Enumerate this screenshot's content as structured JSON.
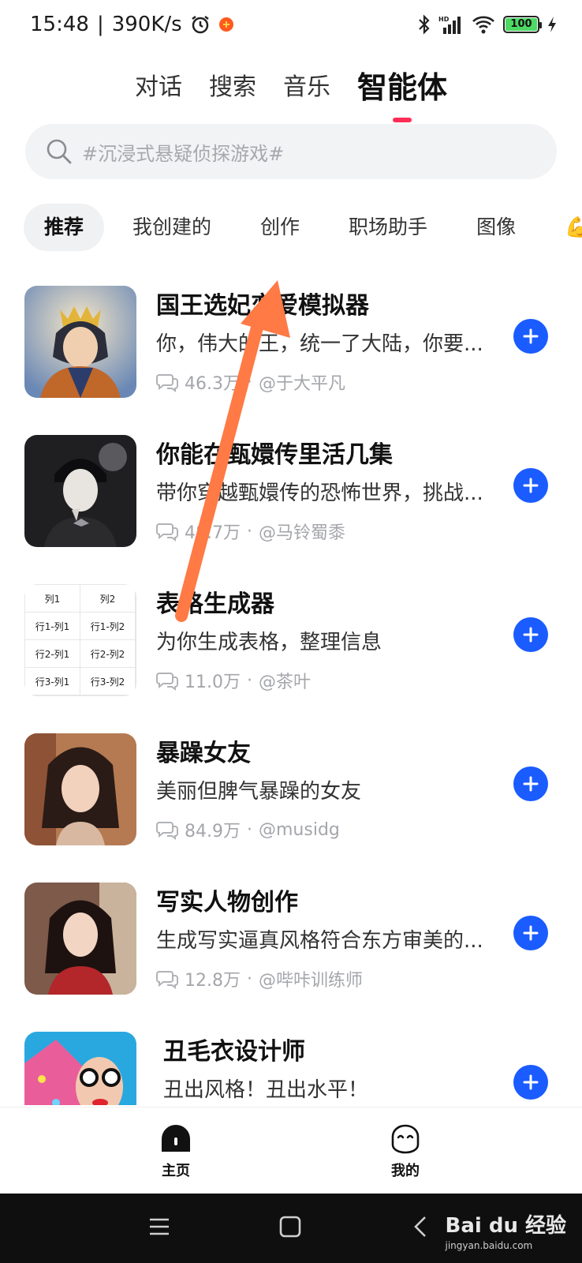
{
  "status": {
    "time": "15:48",
    "speed": "390K/s",
    "battery": "100"
  },
  "top_tabs": [
    {
      "label": "对话",
      "active": false
    },
    {
      "label": "搜索",
      "active": false
    },
    {
      "label": "音乐",
      "active": false
    },
    {
      "label": "智能体",
      "active": true
    }
  ],
  "search": {
    "placeholder": "#沉浸式悬疑侦探游戏#"
  },
  "categories": [
    {
      "label": "推荐",
      "active": true
    },
    {
      "label": "我创建的"
    },
    {
      "label": "创作"
    },
    {
      "label": "职场助手"
    },
    {
      "label": "图像"
    },
    {
      "label": "💪"
    }
  ],
  "items": [
    {
      "title": "国王选妃恋爱模拟器",
      "desc": "你，伟大的王，统一了大陆，你要...",
      "count": "46.3万",
      "author": "@于大平凡"
    },
    {
      "title": "你能在甄嬛传里活几集",
      "desc": "带你穿越甄嬛传的恐怖世界，挑战...",
      "count": "48.7万",
      "author": "@马铃蜀黍"
    },
    {
      "title": "表格生成器",
      "desc": "为你生成表格，整理信息",
      "count": "11.0万",
      "author": "@茶叶"
    },
    {
      "title": "暴躁女友",
      "desc": "美丽但脾气暴躁的女友",
      "count": "84.9万",
      "author": "@musidg"
    },
    {
      "title": "写实人物创作",
      "desc": "生成写实逼真风格符合东方审美的...",
      "count": "12.8万",
      "author": "@哔咔训练师"
    },
    {
      "title": "丑毛衣设计师",
      "desc": "丑出风格！丑出水平！",
      "count": "",
      "author": ""
    }
  ],
  "table_thumb": {
    "cells": [
      "列1",
      "列2",
      "行1-列1",
      "行1-列2",
      "行2-列1",
      "行2-列2",
      "行3-列1",
      "行3-列2"
    ]
  },
  "bottom_nav": {
    "home": "主页",
    "mine": "我的"
  },
  "watermark": {
    "brand": "Bai du 经验",
    "site": "jingyan.baidu.com"
  },
  "colors": {
    "accent_blue": "#1a5cff",
    "tab_underline": "#ff2d55",
    "arrow": "#ff7a45"
  }
}
